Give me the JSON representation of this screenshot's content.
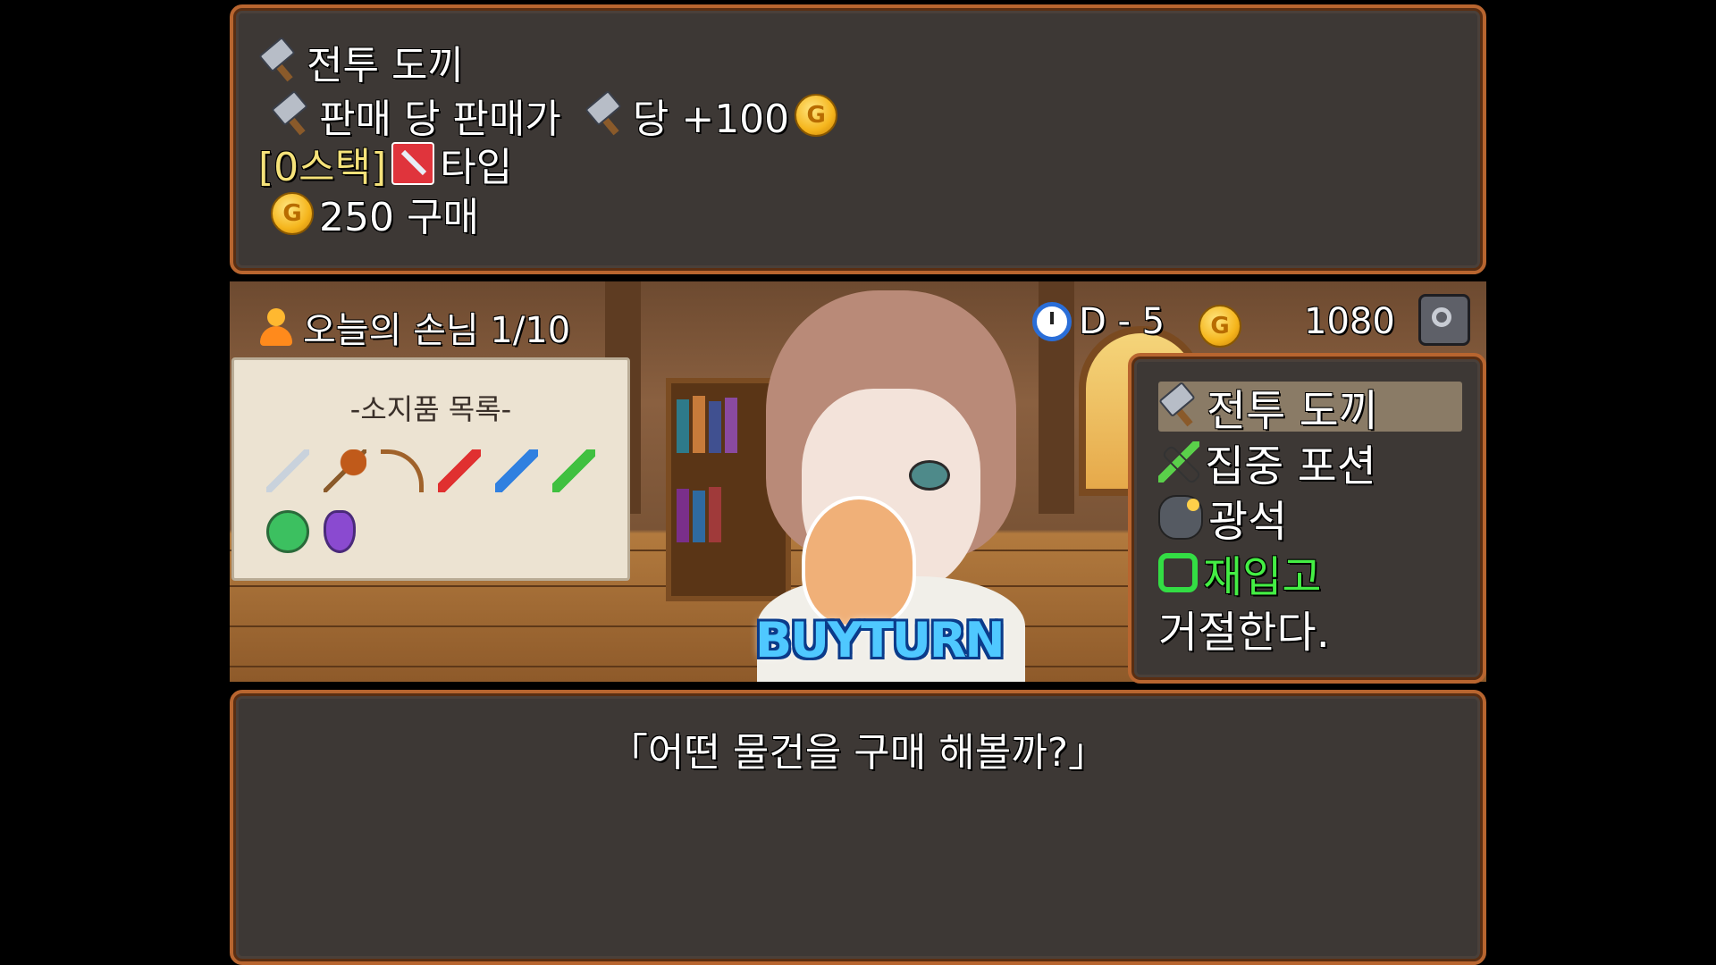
{
  "info_panel": {
    "item_name": "전투 도끼",
    "sale_text_1": "판매 당 판매가",
    "sale_text_2": "당 +100",
    "stack_label": "[0스택]",
    "type_label": "타입",
    "buy_text": "250 구매"
  },
  "hud": {
    "guests_label": "오늘의 손님 1/10",
    "day": "D - 5",
    "gold": "1080"
  },
  "inventory": {
    "title": "-소지품 목록-",
    "items": [
      "sword-icon",
      "mace-icon",
      "bow-icon",
      "red-potion-icon",
      "blue-potion-icon",
      "green-potion-icon",
      "green-flask-icon",
      "purple-flask-icon"
    ]
  },
  "badge": "BUYTURN",
  "menu": {
    "options": [
      {
        "label": "전투 도끼",
        "icon": "axe-icon",
        "selected": true
      },
      {
        "label": "집중 포션",
        "icon": "potion-icon",
        "selected": false
      },
      {
        "label": "광석",
        "icon": "ore-icon",
        "selected": false
      },
      {
        "label": "재입고",
        "icon": "restock-icon",
        "selected": false
      },
      {
        "label": "거절한다.",
        "icon": "",
        "selected": false
      }
    ]
  },
  "dialog": {
    "message": "「어떤 물건을 구매 해볼까?」"
  },
  "colors": {
    "panel_bg": "#3d3835",
    "panel_border": "#b8652f",
    "highlight": "#8a7b66",
    "restock_green": "#44ee44",
    "stack_yellow": "#f5e27a"
  }
}
